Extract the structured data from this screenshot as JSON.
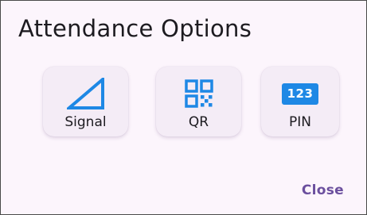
{
  "dialog": {
    "title": "Attendance Options",
    "close_label": "Close"
  },
  "options": [
    {
      "label": "Signal",
      "icon": "signal-icon"
    },
    {
      "label": "QR",
      "icon": "qr-code-icon"
    },
    {
      "label": "PIN",
      "icon": "pin-icon",
      "badge_text": "123"
    }
  ],
  "colors": {
    "accent_blue": "#1e88e5",
    "close_text": "#6b4f9e",
    "dialog_background": "#fcf5fc",
    "card_background": "#f4ecf6"
  }
}
